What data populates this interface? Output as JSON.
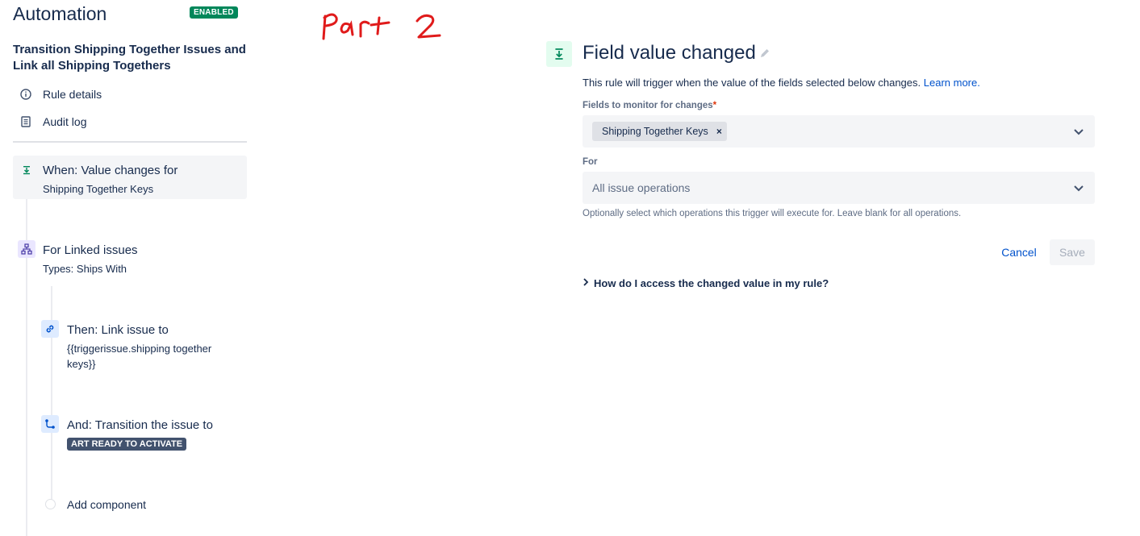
{
  "sidebar": {
    "title": "Automation",
    "status_badge": "ENABLED",
    "rule_name": "Transition Shipping Together Issues and Link all Shipping Togethers",
    "nav": [
      {
        "label": "Rule details",
        "icon": "info-icon"
      },
      {
        "label": "Audit log",
        "icon": "document-icon"
      }
    ],
    "components": {
      "trigger": {
        "title": "When: Value changes for",
        "subtitle": "Shipping Together Keys",
        "icon": "trigger-icon"
      },
      "branch": {
        "title": "For Linked issues",
        "subtitle": "Types: Ships With",
        "icon": "hierarchy-icon"
      },
      "action_link": {
        "title": "Then: Link issue to",
        "subtitle": "{{triggerissue.shipping together keys}}",
        "icon": "link-icon"
      },
      "action_transition": {
        "title": "And: Transition the issue to",
        "status": "ART READY TO ACTIVATE",
        "icon": "transition-icon"
      },
      "add_component": "Add component"
    }
  },
  "panel": {
    "title": "Field value changed",
    "description": "This rule will trigger when the value of the fields selected below changes.",
    "learn_more": "Learn more.",
    "fields_label": "Fields to monitor for changes",
    "required_mark": "*",
    "selected_field": "Shipping Together Keys",
    "remove_symbol": "×",
    "for_label": "For",
    "for_placeholder": "All issue operations",
    "help_text": "Optionally select which operations this trigger will execute for. Leave blank for all operations.",
    "cancel": "Cancel",
    "save": "Save",
    "expander": "How do I access the changed value in my rule?"
  },
  "annotation": {
    "text": "Part 2",
    "color": "#e01b1b"
  },
  "colors": {
    "enabled_green": "#00875a",
    "link_blue": "#0052cc",
    "status_lozenge": "#42526e"
  }
}
